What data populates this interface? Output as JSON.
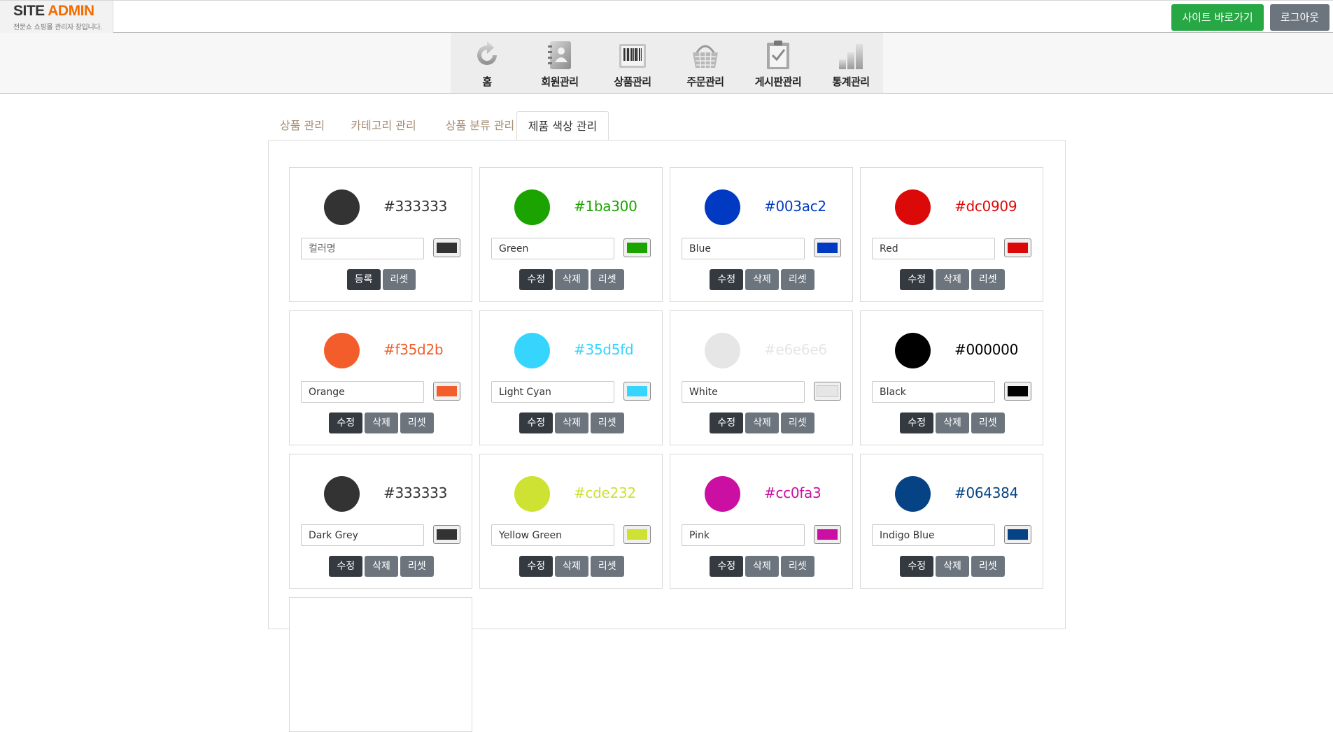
{
  "header": {
    "logo_site": "SITE",
    "logo_admin": "ADMIN",
    "tagline": "전문쇼 쇼핑몰 관리자 창입니다.",
    "site_button": "사이트 바로가기",
    "logout_button": "로그아웃"
  },
  "nav": {
    "items": [
      {
        "label": "홈",
        "icon": "refresh-home-icon"
      },
      {
        "label": "회원관리",
        "icon": "address-book-icon"
      },
      {
        "label": "상품관리",
        "icon": "barcode-icon"
      },
      {
        "label": "주문관리",
        "icon": "shopping-basket-icon"
      },
      {
        "label": "게시판관리",
        "icon": "clipboard-check-icon"
      },
      {
        "label": "통계관리",
        "icon": "bar-chart-icon"
      }
    ]
  },
  "tabs": [
    {
      "label": "상품 관리",
      "active": false
    },
    {
      "label": "카테고리 관리",
      "active": false
    },
    {
      "label": "상품 분류 관리",
      "active": false
    },
    {
      "label": "제품 색상 관리",
      "active": true
    }
  ],
  "colors": [
    {
      "hex": "#333333",
      "name": "",
      "placeholder": "컬러명",
      "new": true
    },
    {
      "hex": "#1ba300",
      "name": "Green"
    },
    {
      "hex": "#003ac2",
      "name": "Blue"
    },
    {
      "hex": "#dc0909",
      "name": "Red"
    },
    {
      "hex": "#f35d2b",
      "name": "Orange"
    },
    {
      "hex": "#35d5fd",
      "name": "Light Cyan"
    },
    {
      "hex": "#e6e6e6",
      "name": "White"
    },
    {
      "hex": "#000000",
      "name": "Black"
    },
    {
      "hex": "#333333",
      "name": "Dark Grey"
    },
    {
      "hex": "#cde232",
      "name": "Yellow Green"
    },
    {
      "hex": "#cc0fa3",
      "name": "Pink"
    },
    {
      "hex": "#064384",
      "name": "Indigo Blue"
    }
  ],
  "card_buttons": {
    "register": "등록",
    "edit": "수정",
    "delete": "삭제",
    "reset": "리셋"
  }
}
